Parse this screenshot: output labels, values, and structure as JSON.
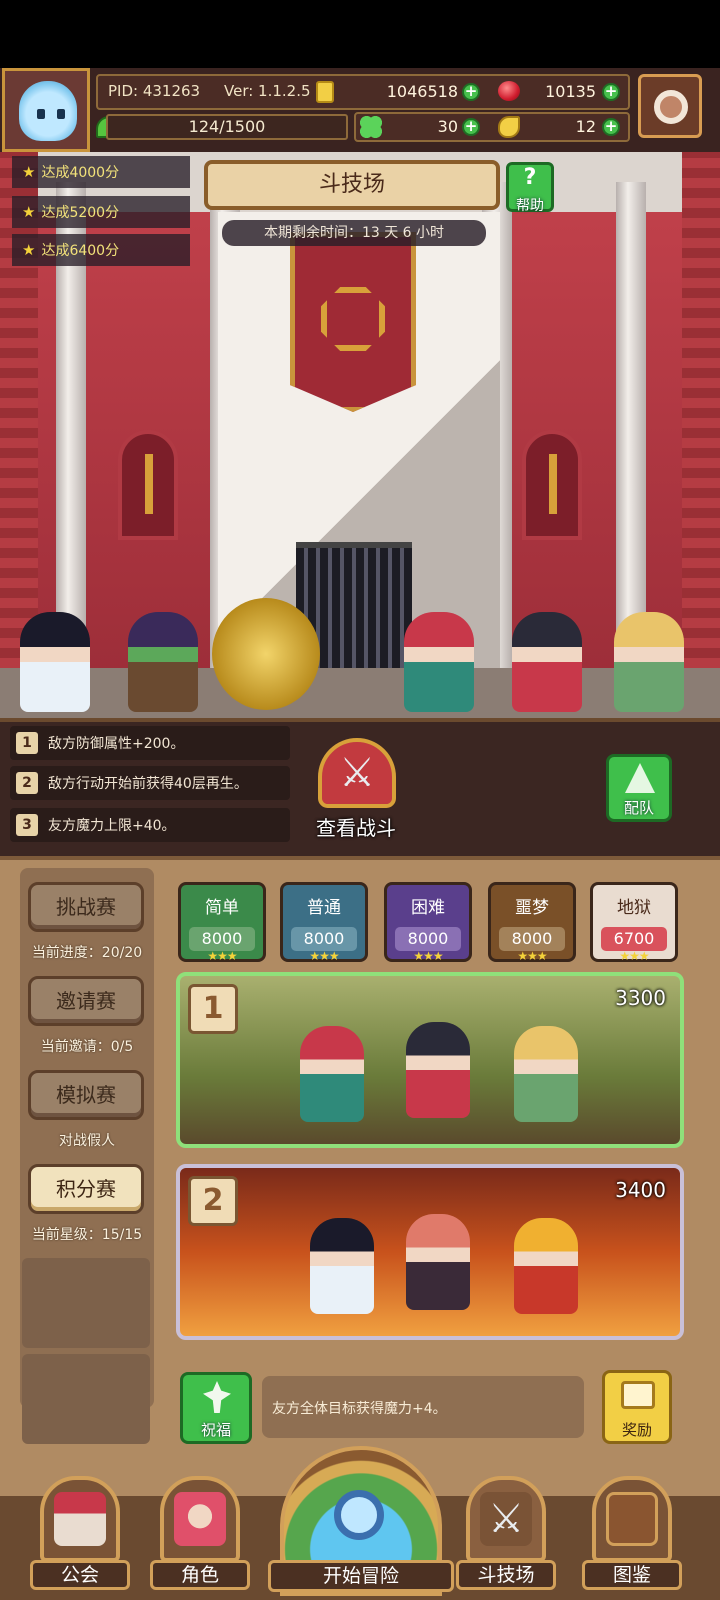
{
  "header": {
    "pid": "PID: 431263",
    "version": "Ver: 1.1.2.5",
    "gold": "1046518",
    "rubies": "10135",
    "energy": "124/1500",
    "clovers": "30",
    "horns": "12",
    "icons": {
      "gold": "gold-coin-icon",
      "ruby": "ruby-gem-icon",
      "energy": "leaf-energy-icon",
      "clover": "clover-icon",
      "horn": "horn-icon",
      "settings": "gear-icon"
    }
  },
  "arena": {
    "title": "斗技场",
    "help_label": "帮助",
    "timer": "本期剩余时间：13 天 6 小时",
    "goals": [
      "达成4000分",
      "达成5200分",
      "达成6400分"
    ]
  },
  "modifiers": {
    "items": [
      {
        "num": "1",
        "text": "敌方防御属性+200。"
      },
      {
        "num": "2",
        "text": "敌方行动开始前获得40层再生。"
      },
      {
        "num": "3",
        "text": "友方魔力上限+40。"
      }
    ],
    "view_battle": "查看战斗",
    "team": "配队"
  },
  "modes": {
    "challenge": {
      "label": "挑战赛",
      "info": "当前进度：20/20"
    },
    "invite": {
      "label": "邀请赛",
      "info": "当前邀请：0/5"
    },
    "simulation": {
      "label": "模拟赛",
      "info": "对战假人"
    },
    "points": {
      "label": "积分赛",
      "info": "当前星级：15/15"
    }
  },
  "difficulties": [
    {
      "label": "简单",
      "value": "8000",
      "stars": "★★★",
      "color": "#3b8a4a",
      "val_bg": "#6aa46f"
    },
    {
      "label": "普通",
      "value": "8000",
      "stars": "★★★",
      "color": "#3c6f86",
      "val_bg": "#6896a8"
    },
    {
      "label": "困难",
      "value": "8000",
      "stars": "★★★",
      "color": "#5a3f8c",
      "val_bg": "#8a70b4"
    },
    {
      "label": "噩梦",
      "value": "8000",
      "stars": "★★★",
      "color": "#7a5028",
      "val_bg": "#a3825a"
    },
    {
      "label": "地狱",
      "value": "6700",
      "stars": "★★★",
      "color": "#e9dcd0",
      "val_bg": "#d9525c"
    }
  ],
  "matches": [
    {
      "num": "1",
      "score": "3300"
    },
    {
      "num": "2",
      "score": "3400"
    }
  ],
  "blessing": {
    "label": "祝福",
    "text": "友方全体目标获得魔力+4。"
  },
  "reward": {
    "label": "奖励"
  },
  "nav": {
    "guild": "公会",
    "role": "角色",
    "adventure": "开始冒险",
    "arena": "斗技场",
    "codex": "图鉴"
  }
}
